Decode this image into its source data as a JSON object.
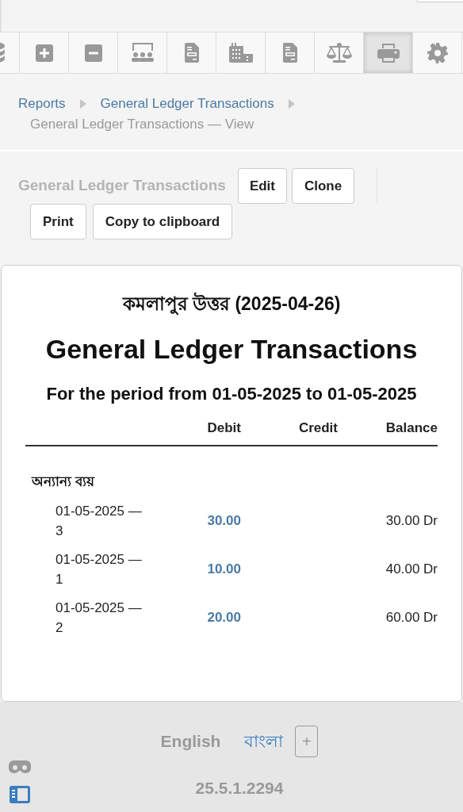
{
  "toolbar": [
    {
      "kind": "database",
      "selected": false
    },
    {
      "kind": "plus",
      "selected": false
    },
    {
      "kind": "minus",
      "selected": false
    },
    {
      "kind": "group",
      "selected": false
    },
    {
      "kind": "document",
      "selected": false
    },
    {
      "kind": "building",
      "selected": false
    },
    {
      "kind": "document",
      "selected": false
    },
    {
      "kind": "scale",
      "selected": false
    },
    {
      "kind": "print",
      "selected": true
    },
    {
      "kind": "settings",
      "selected": false
    }
  ],
  "breadcrumbs": [
    "Reports",
    "General Ledger Transactions",
    "General Ledger Transactions — View"
  ],
  "page_title": "General Ledger Transactions",
  "actions": [
    "Edit",
    "Clone",
    "Print",
    "Copy to clipboard"
  ],
  "report": {
    "company": "কমলাপুর উত্তর (2025-04-26)",
    "title": "General Ledger Transactions",
    "period": "For the period from 01-05-2025 to 01-05-2025",
    "columns": [
      "Debit",
      "Credit",
      "Balance"
    ],
    "account": "অন্যান্য ব্যয়",
    "rows": [
      {
        "date": "01-05-2025 — 3",
        "debit": "30.00",
        "balance": "30.00 Dr"
      },
      {
        "date": "01-05-2025 — 1",
        "debit": "10.00",
        "balance": "40.00 Dr"
      },
      {
        "date": "01-05-2025 — 2",
        "debit": "20.00",
        "balance": "60.00 Dr"
      }
    ]
  },
  "footer": {
    "languages": [
      {
        "label": "English",
        "selected": true
      },
      {
        "label": "বাংলা",
        "selected": false
      }
    ],
    "add_button": "+",
    "version": "25.5.1.2294"
  }
}
